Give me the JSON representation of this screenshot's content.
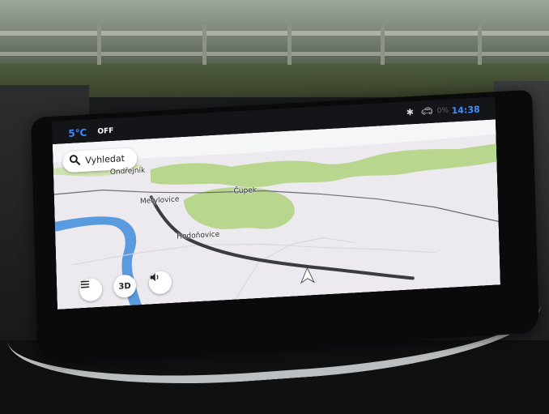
{
  "status_bar": {
    "temperature": "5℃",
    "ac_state": "OFF",
    "bluetooth_icon": "bluetooth-icon",
    "car_icon": "car-icon",
    "dim_indicator": "0%",
    "time": "14:38"
  },
  "map": {
    "search_label": "Vyhledat",
    "place_labels": [
      "Ondřejník",
      "Metylovice",
      "Čupek",
      "Hodoňovice"
    ],
    "colors": {
      "land": "#ece9ef",
      "forest": "#b9d68f",
      "water": "#5a9be0",
      "route": "#3b3c40",
      "sky": "#f5f6f8"
    }
  },
  "controls": {
    "menu_icon": "menu-icon",
    "view_mode_label": "3D",
    "sound_icon": "speaker-icon"
  },
  "status_colors": {
    "accent": "#3f8cff"
  }
}
